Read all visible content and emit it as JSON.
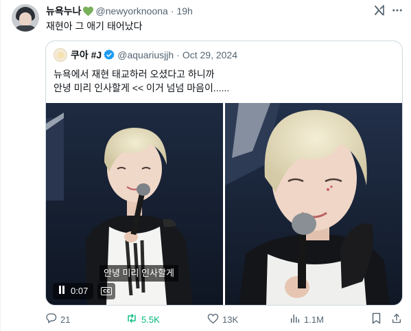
{
  "tweet": {
    "author_name": "뉴욕누나",
    "author_handle": "@newyorknoona",
    "separator": "·",
    "time": "19h",
    "text": "재현아 그 애기 태어났다"
  },
  "quoted": {
    "author_name": "쿠아 #J",
    "author_handle": "@aquariusjjh",
    "separator": "·",
    "date": "Oct 29, 2024",
    "text_lines": [
      "뉴욕에서 재현 태교하러 오셨다고 하니까",
      "안녕 미리 인사할게 << 이거 넘넘 마음이......"
    ],
    "video": {
      "subtitle": "안녕 미리 인사할게",
      "time": "0:07",
      "cc_label": "CC"
    }
  },
  "actions": {
    "replies": "21",
    "reposts": "5.5K",
    "likes": "13K",
    "views": "1.1M"
  },
  "colors": {
    "text": "#0f1419",
    "secondary": "#536471",
    "border": "#cfd9de",
    "verified": "#1d9bf0",
    "repost_active": "#00ba7c",
    "heart_green": "#78b159"
  },
  "icons": [
    "grok-icon",
    "more-icon",
    "green-heart-icon",
    "verified-badge-icon",
    "pause-icon",
    "cc-icon",
    "reply-icon",
    "repost-icon",
    "like-icon",
    "views-icon",
    "bookmark-icon",
    "share-icon"
  ]
}
